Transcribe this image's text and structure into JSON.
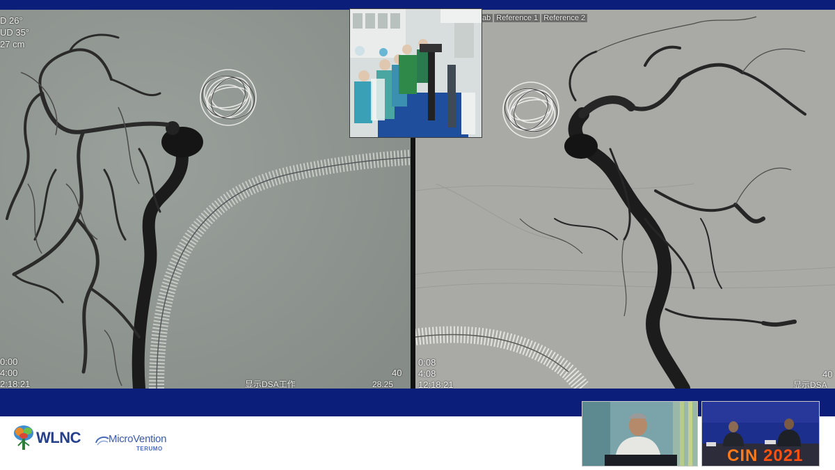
{
  "left_overlay": {
    "angle_1": "D    26°",
    "angle_2": "UD  35°",
    "distance": "27 cm",
    "time_1": "0:00",
    "time_2": "4:00",
    "clock": "2:18:21",
    "bottom_right_num": "40",
    "bottom_right_small": "28.25",
    "bottom_center": "显示DSA工作"
  },
  "right_overlay": {
    "header_tags": [
      "ab",
      "Reference 1",
      "Reference 2"
    ],
    "time_1": "0:08",
    "time_2": "4:08",
    "clock": "12:18:21",
    "bottom_right_num": "40",
    "bottom_right_small": "显示DSA"
  },
  "footer": {
    "wlnc_label": "WLNC",
    "microvention_label": "MicroVention",
    "terumo_label": "TERUMO"
  },
  "panel_cam": {
    "event_text_1": "CIN",
    "event_text_2": "2021"
  },
  "colors": {
    "brand_blue": "#0b1f7a",
    "accent_orange": "#ff6a1a"
  }
}
